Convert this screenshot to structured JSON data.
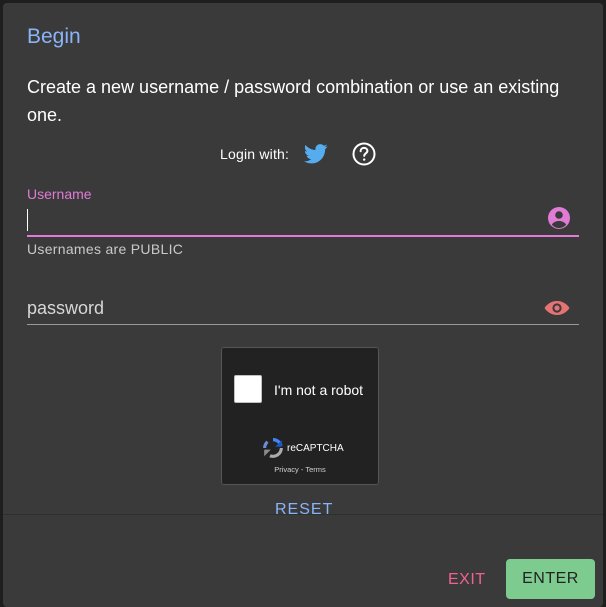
{
  "dialog": {
    "title": "Begin",
    "description": "Create a new username / password combination or use an existing one."
  },
  "login": {
    "label": "Login with:",
    "twitter_icon": "twitter-bird-icon",
    "help_icon": "help-circle-icon"
  },
  "username": {
    "label": "Username",
    "value": "",
    "placeholder": "",
    "hint": "Usernames are PUBLIC",
    "icon": "account-circle-icon"
  },
  "password": {
    "value": "",
    "placeholder": "password",
    "icon": "eye-icon"
  },
  "captcha": {
    "checkbox_label": "I'm not a robot",
    "brand": "reCAPTCHA",
    "privacy": "Privacy",
    "separator": " - ",
    "terms": "Terms"
  },
  "actions": {
    "reset": "RESET",
    "exit": "EXIT",
    "enter": "ENTER"
  },
  "colors": {
    "dialog_bg": "#3a3a3a",
    "title_blue": "#8ab4f8",
    "focus_pink": "#e07bd6",
    "eye_red": "#e57373",
    "exit_pink": "#f06292",
    "enter_green": "#7ecb8f",
    "twitter_blue": "#55acee"
  }
}
